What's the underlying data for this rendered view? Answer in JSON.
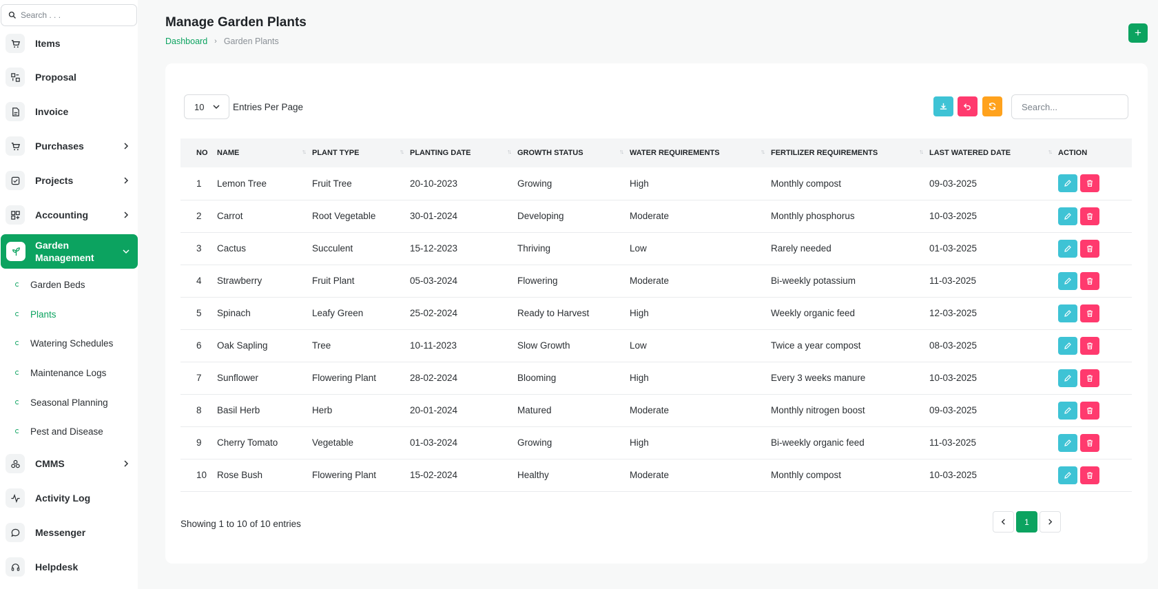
{
  "sidebar": {
    "search_placeholder": "Search . . .",
    "items": [
      {
        "label": "Items"
      },
      {
        "label": "Proposal"
      },
      {
        "label": "Invoice"
      },
      {
        "label": "Purchases"
      },
      {
        "label": "Projects"
      },
      {
        "label": "Accounting"
      },
      {
        "label": "Garden Management"
      },
      {
        "label": "CMMS"
      },
      {
        "label": "Activity Log"
      },
      {
        "label": "Messenger"
      },
      {
        "label": "Helpdesk"
      }
    ],
    "sub_items": [
      {
        "label": "Garden Beds"
      },
      {
        "label": "Plants"
      },
      {
        "label": "Watering Schedules"
      },
      {
        "label": "Maintenance Logs"
      },
      {
        "label": "Seasonal Planning"
      },
      {
        "label": "Pest and Disease"
      }
    ],
    "accent": "#0ca360"
  },
  "header": {
    "title": "Manage Garden Plants",
    "breadcrumb_home": "Dashboard",
    "breadcrumb_current": "Garden Plants",
    "add_label": "+"
  },
  "table_controls": {
    "entries_value": "10",
    "entries_label": "Entries Per Page",
    "search_placeholder": "Search..."
  },
  "table": {
    "headers": [
      "NO",
      "NAME",
      "PLANT TYPE",
      "PLANTING DATE",
      "GROWTH STATUS",
      "WATER REQUIREMENTS",
      "FERTILIZER REQUIREMENTS",
      "LAST WATERED DATE",
      "ACTION"
    ],
    "rows": [
      [
        "1",
        "Lemon Tree",
        "Fruit Tree",
        "20-10-2023",
        "Growing",
        "High",
        "Monthly compost",
        "09-03-2025"
      ],
      [
        "2",
        "Carrot",
        "Root Vegetable",
        "30-01-2024",
        "Developing",
        "Moderate",
        "Monthly phosphorus",
        "10-03-2025"
      ],
      [
        "3",
        "Cactus",
        "Succulent",
        "15-12-2023",
        "Thriving",
        "Low",
        "Rarely needed",
        "01-03-2025"
      ],
      [
        "4",
        "Strawberry",
        "Fruit Plant",
        "05-03-2024",
        "Flowering",
        "Moderate",
        "Bi-weekly potassium",
        "11-03-2025"
      ],
      [
        "5",
        "Spinach",
        "Leafy Green",
        "25-02-2024",
        "Ready to Harvest",
        "High",
        "Weekly organic feed",
        "12-03-2025"
      ],
      [
        "6",
        "Oak Sapling",
        "Tree",
        "10-11-2023",
        "Slow Growth",
        "Low",
        "Twice a year compost",
        "08-03-2025"
      ],
      [
        "7",
        "Sunflower",
        "Flowering Plant",
        "28-02-2024",
        "Blooming",
        "High",
        "Every 3 weeks manure",
        "10-03-2025"
      ],
      [
        "8",
        "Basil Herb",
        "Herb",
        "20-01-2024",
        "Matured",
        "Moderate",
        "Monthly nitrogen boost",
        "09-03-2025"
      ],
      [
        "9",
        "Cherry Tomato",
        "Vegetable",
        "01-03-2024",
        "Growing",
        "High",
        "Bi-weekly organic feed",
        "11-03-2025"
      ],
      [
        "10",
        "Rose Bush",
        "Flowering Plant",
        "15-02-2024",
        "Healthy",
        "Moderate",
        "Monthly compost",
        "10-03-2025"
      ]
    ]
  },
  "footer": {
    "showing": "Showing 1 to 10 of 10 entries",
    "current_page": "1"
  },
  "colors": {
    "edit": "#3ec3d5",
    "delete": "#ff3a6e",
    "sync": "#ffa21d"
  }
}
